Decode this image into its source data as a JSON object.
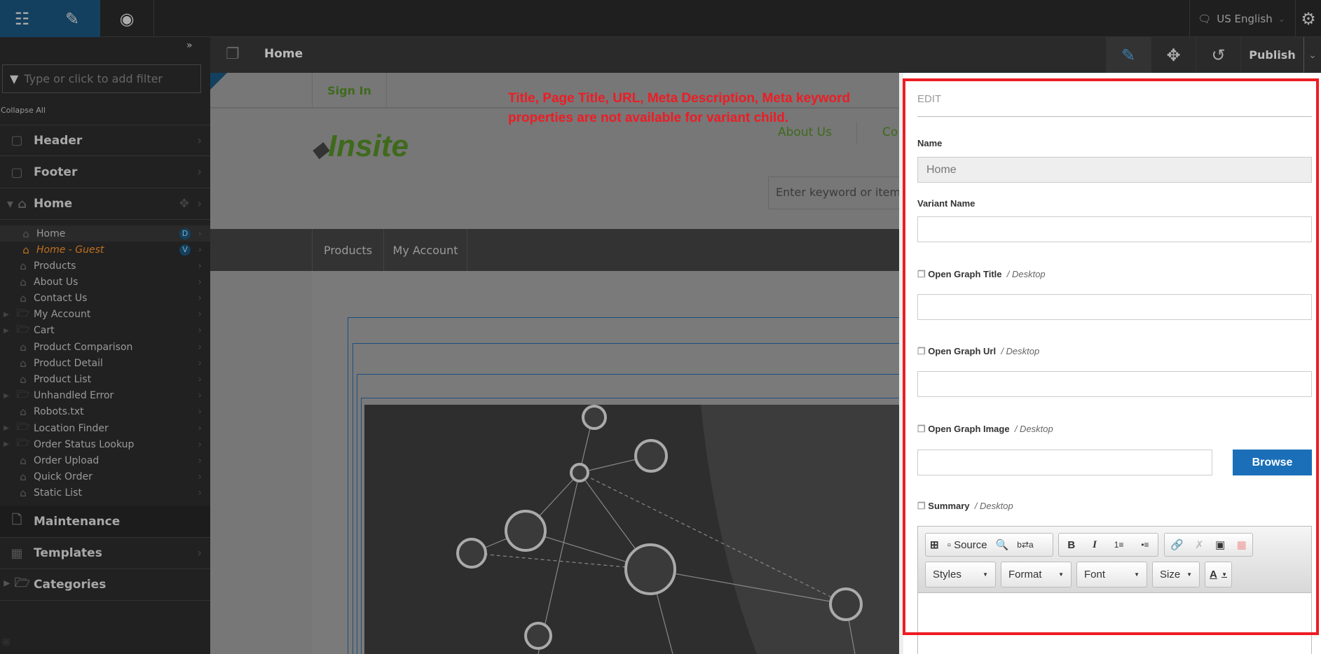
{
  "topbar": {
    "language": "US English",
    "icons": [
      "sitemap-icon",
      "pencil-icon",
      "eye-icon",
      "chat-icon",
      "gear-icon"
    ]
  },
  "subbar": {
    "page_title": "Home",
    "publish_label": "Publish"
  },
  "sidebar": {
    "filter_placeholder": "Type or click to add filter",
    "collapse_all": "Collapse All",
    "sections": [
      {
        "label": "Header"
      },
      {
        "label": "Footer"
      },
      {
        "label": "Home"
      }
    ],
    "home_children": [
      {
        "label": "Home",
        "badge": "D"
      },
      {
        "label": "Home - Guest",
        "badge": "V"
      }
    ],
    "pages": [
      {
        "label": "Products",
        "type": "page"
      },
      {
        "label": "About Us",
        "type": "page"
      },
      {
        "label": "Contact Us",
        "type": "page"
      },
      {
        "label": "My Account",
        "type": "folder"
      },
      {
        "label": "Cart",
        "type": "folder"
      },
      {
        "label": "Product Comparison",
        "type": "page"
      },
      {
        "label": "Product Detail",
        "type": "page"
      },
      {
        "label": "Product List",
        "type": "page"
      },
      {
        "label": "Unhandled Error",
        "type": "folder"
      },
      {
        "label": "Robots.txt",
        "type": "page"
      },
      {
        "label": "Location Finder",
        "type": "folder"
      },
      {
        "label": "Order Status Lookup",
        "type": "folder"
      },
      {
        "label": "Order Upload",
        "type": "page"
      },
      {
        "label": "Quick Order",
        "type": "page"
      },
      {
        "label": "Static List",
        "type": "page"
      }
    ],
    "bottom": [
      {
        "label": "Maintenance"
      },
      {
        "label": "Templates"
      },
      {
        "label": "Categories"
      }
    ]
  },
  "preview": {
    "sign_in": "Sign In",
    "logo": "Insite",
    "about_us": "About Us",
    "contact_partial": "Co",
    "search_placeholder": "Enter keyword or item #",
    "nav": [
      "Products",
      "My Account"
    ]
  },
  "annotation": {
    "line1": "Title, Page Title, URL, Meta Description, Meta keyword",
    "line2": "properties are not available for variant child.",
    "color": "#ee1c24"
  },
  "panel": {
    "heading": "EDIT",
    "name_label": "Name",
    "name_value": "Home",
    "variant_label": "Variant Name",
    "variant_value": "",
    "og_title_label": "Open Graph Title",
    "og_url_label": "Open Graph Url",
    "og_image_label": "Open Graph Image",
    "summary_label": "Summary",
    "device": "/ Desktop",
    "browse": "Browse",
    "editor": {
      "source": "Source",
      "styles": "Styles",
      "format": "Format",
      "font": "Font",
      "size": "Size",
      "color_a": "A"
    }
  }
}
